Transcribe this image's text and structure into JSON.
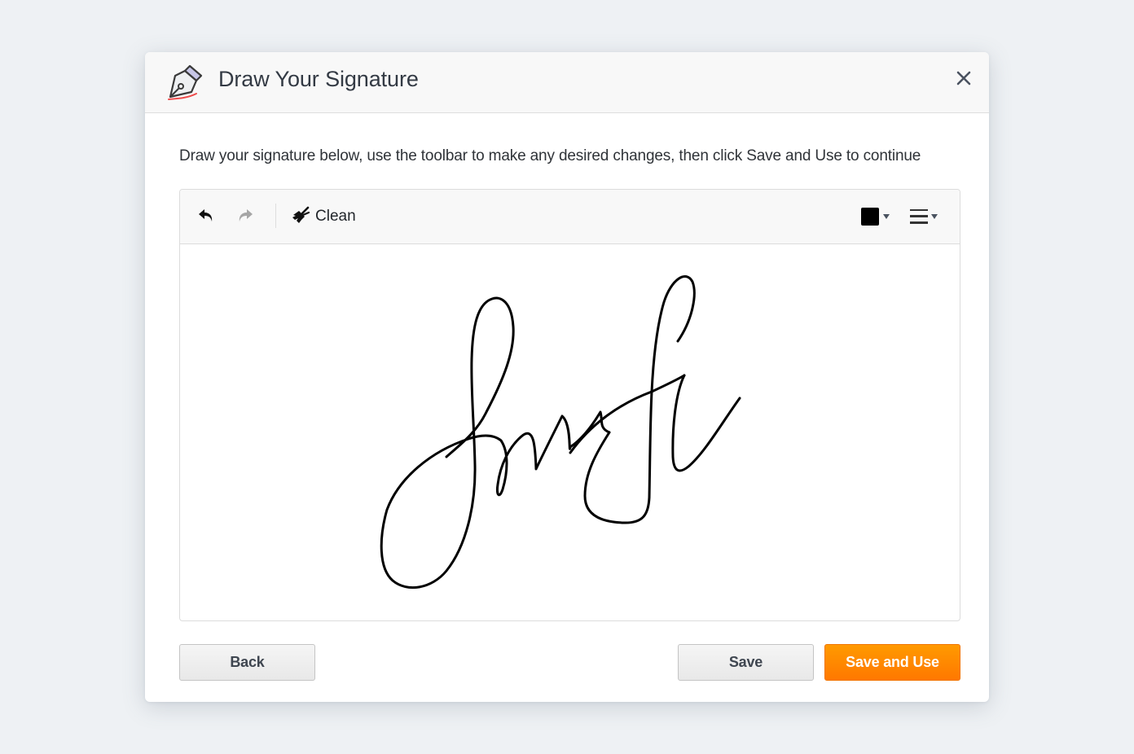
{
  "dialog": {
    "title": "Draw Your Signature",
    "header_icon": "fountain-pen-icon",
    "close_icon": "close-icon"
  },
  "instructions": "Draw your signature below, use the toolbar to make any desired changes, then click Save and Use to continue",
  "toolbar": {
    "undo_icon": "undo-icon",
    "redo_icon": "redo-icon",
    "clean_icon": "broom-icon",
    "clean_label": "Clean",
    "pen_color": "#000000",
    "color_dropdown_icon": "caret-down-icon",
    "line_width_icon": "line-width-icon"
  },
  "signature": {
    "stroke_color": "#000000",
    "has_content": true
  },
  "buttons": {
    "back_label": "Back",
    "save_label": "Save",
    "save_and_use_label": "Save and Use"
  },
  "colors": {
    "accent": "#ff8a00",
    "page_background": "#eef1f4",
    "header_background": "#f8f8f8"
  }
}
